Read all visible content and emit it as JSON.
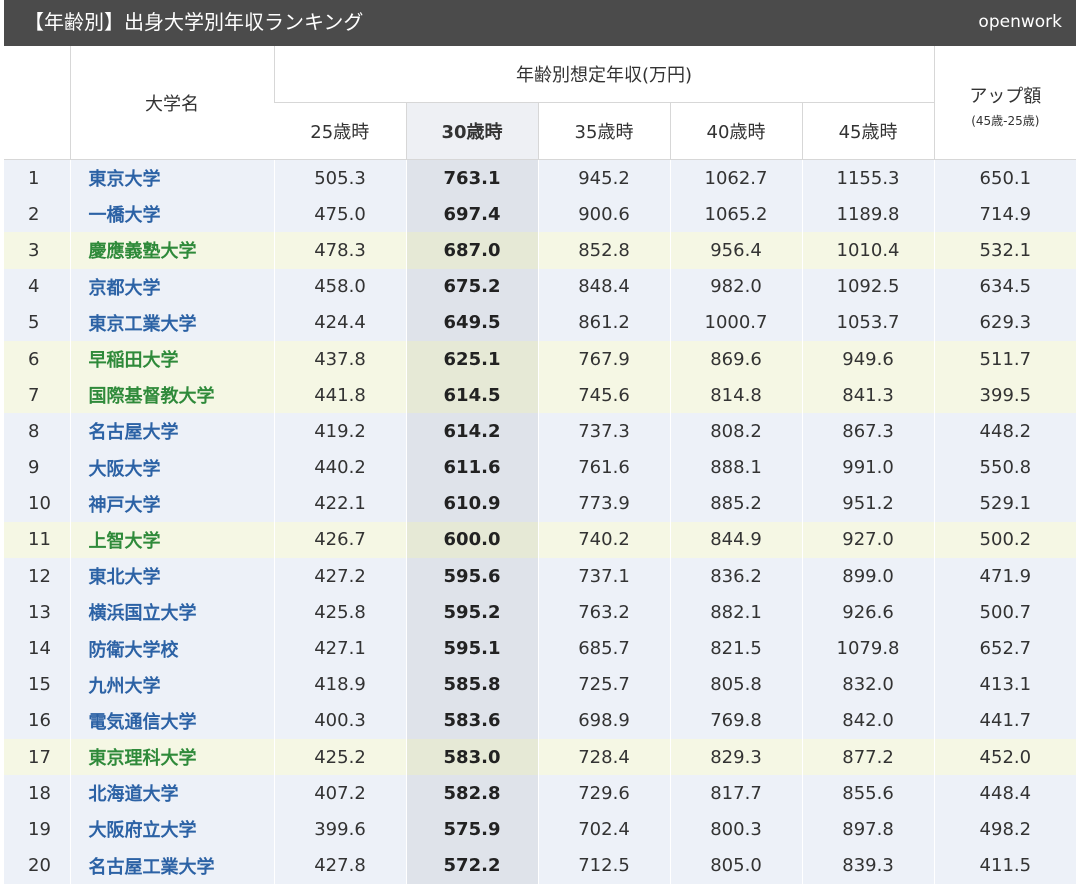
{
  "header": {
    "title": "【年齢別】出身大学別年収ランキング",
    "brand": "openwork"
  },
  "table": {
    "headers": {
      "university": "大学名",
      "group": "年齢別想定年収(万円)",
      "ages": [
        "25歳時",
        "30歳時",
        "35歳時",
        "40歳時",
        "45歳時"
      ],
      "increase": "アップ額",
      "increase_note": "(45歳-25歳)"
    },
    "rows": [
      {
        "rank": "1",
        "name": "東京大学",
        "v25": "505.3",
        "v30": "763.1",
        "v35": "945.2",
        "v40": "1062.7",
        "v45": "1155.3",
        "up": "650.1",
        "tint": "blue"
      },
      {
        "rank": "2",
        "name": "一橋大学",
        "v25": "475.0",
        "v30": "697.4",
        "v35": "900.6",
        "v40": "1065.2",
        "v45": "1189.8",
        "up": "714.9",
        "tint": "blue"
      },
      {
        "rank": "3",
        "name": "慶應義塾大学",
        "v25": "478.3",
        "v30": "687.0",
        "v35": "852.8",
        "v40": "956.4",
        "v45": "1010.4",
        "up": "532.1",
        "tint": "yellow"
      },
      {
        "rank": "4",
        "name": "京都大学",
        "v25": "458.0",
        "v30": "675.2",
        "v35": "848.4",
        "v40": "982.0",
        "v45": "1092.5",
        "up": "634.5",
        "tint": "blue"
      },
      {
        "rank": "5",
        "name": "東京工業大学",
        "v25": "424.4",
        "v30": "649.5",
        "v35": "861.2",
        "v40": "1000.7",
        "v45": "1053.7",
        "up": "629.3",
        "tint": "blue"
      },
      {
        "rank": "6",
        "name": "早稲田大学",
        "v25": "437.8",
        "v30": "625.1",
        "v35": "767.9",
        "v40": "869.6",
        "v45": "949.6",
        "up": "511.7",
        "tint": "yellow"
      },
      {
        "rank": "7",
        "name": "国際基督教大学",
        "v25": "441.8",
        "v30": "614.5",
        "v35": "745.6",
        "v40": "814.8",
        "v45": "841.3",
        "up": "399.5",
        "tint": "yellow"
      },
      {
        "rank": "8",
        "name": "名古屋大学",
        "v25": "419.2",
        "v30": "614.2",
        "v35": "737.3",
        "v40": "808.2",
        "v45": "867.3",
        "up": "448.2",
        "tint": "blue"
      },
      {
        "rank": "9",
        "name": "大阪大学",
        "v25": "440.2",
        "v30": "611.6",
        "v35": "761.6",
        "v40": "888.1",
        "v45": "991.0",
        "up": "550.8",
        "tint": "blue"
      },
      {
        "rank": "10",
        "name": "神戸大学",
        "v25": "422.1",
        "v30": "610.9",
        "v35": "773.9",
        "v40": "885.2",
        "v45": "951.2",
        "up": "529.1",
        "tint": "blue"
      },
      {
        "rank": "11",
        "name": "上智大学",
        "v25": "426.7",
        "v30": "600.0",
        "v35": "740.2",
        "v40": "844.9",
        "v45": "927.0",
        "up": "500.2",
        "tint": "yellow"
      },
      {
        "rank": "12",
        "name": "東北大学",
        "v25": "427.2",
        "v30": "595.6",
        "v35": "737.1",
        "v40": "836.2",
        "v45": "899.0",
        "up": "471.9",
        "tint": "blue"
      },
      {
        "rank": "13",
        "name": "横浜国立大学",
        "v25": "425.8",
        "v30": "595.2",
        "v35": "763.2",
        "v40": "882.1",
        "v45": "926.6",
        "up": "500.7",
        "tint": "blue"
      },
      {
        "rank": "14",
        "name": "防衛大学校",
        "v25": "427.1",
        "v30": "595.1",
        "v35": "685.7",
        "v40": "821.5",
        "v45": "1079.8",
        "up": "652.7",
        "tint": "blue"
      },
      {
        "rank": "15",
        "name": "九州大学",
        "v25": "418.9",
        "v30": "585.8",
        "v35": "725.7",
        "v40": "805.8",
        "v45": "832.0",
        "up": "413.1",
        "tint": "blue"
      },
      {
        "rank": "16",
        "name": "電気通信大学",
        "v25": "400.3",
        "v30": "583.6",
        "v35": "698.9",
        "v40": "769.8",
        "v45": "842.0",
        "up": "441.7",
        "tint": "blue"
      },
      {
        "rank": "17",
        "name": "東京理科大学",
        "v25": "425.2",
        "v30": "583.0",
        "v35": "728.4",
        "v40": "829.3",
        "v45": "877.2",
        "up": "452.0",
        "tint": "yellow"
      },
      {
        "rank": "18",
        "name": "北海道大学",
        "v25": "407.2",
        "v30": "582.8",
        "v35": "729.6",
        "v40": "817.7",
        "v45": "855.6",
        "up": "448.4",
        "tint": "blue"
      },
      {
        "rank": "19",
        "name": "大阪府立大学",
        "v25": "399.6",
        "v30": "575.9",
        "v35": "702.4",
        "v40": "800.3",
        "v45": "897.8",
        "up": "498.2",
        "tint": "blue"
      },
      {
        "rank": "20",
        "name": "名古屋工業大学",
        "v25": "427.8",
        "v30": "572.2",
        "v35": "712.5",
        "v40": "805.0",
        "v45": "839.3",
        "up": "411.5",
        "tint": "blue"
      }
    ]
  }
}
